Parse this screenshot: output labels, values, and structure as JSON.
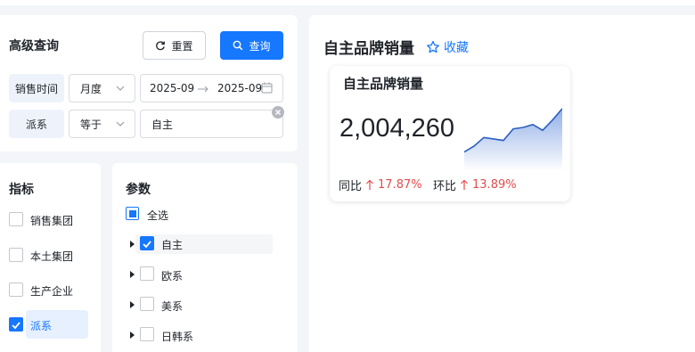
{
  "search": {
    "title": "高级查询",
    "reset_label": "重置",
    "query_label": "查询",
    "sales_time_label": "销售时间",
    "period_select": "月度",
    "range_start": "2025-09",
    "range_end": "2025-09",
    "segment_label": "派系",
    "operator_select": "等于",
    "segment_value": "自主"
  },
  "indicators": {
    "title": "指标",
    "items": [
      {
        "label": "销售集团",
        "checked": false
      },
      {
        "label": "本土集团",
        "checked": false
      },
      {
        "label": "生产企业",
        "checked": false
      },
      {
        "label": "派系",
        "checked": true
      }
    ]
  },
  "params": {
    "title": "参数",
    "select_all": "全选",
    "items": [
      {
        "label": "自主",
        "checked": true
      },
      {
        "label": "欧系",
        "checked": false
      },
      {
        "label": "美系",
        "checked": false
      },
      {
        "label": "日韩系",
        "checked": false
      }
    ]
  },
  "main": {
    "title": "自主品牌销量",
    "favorite_label": "收藏",
    "kpi": {
      "title": "自主品牌销量",
      "value": "2,004,260",
      "yoy_label": "同比",
      "yoy_value": "17.87%",
      "mom_label": "环比",
      "mom_value": "13.89%"
    }
  },
  "colors": {
    "accent": "#1677ff",
    "up": "#e34d4d",
    "spark": "#2a5fc2"
  },
  "chart_data": {
    "type": "area",
    "values": [
      62,
      66,
      72,
      71,
      70,
      78,
      79,
      81,
      77,
      84,
      92
    ]
  }
}
